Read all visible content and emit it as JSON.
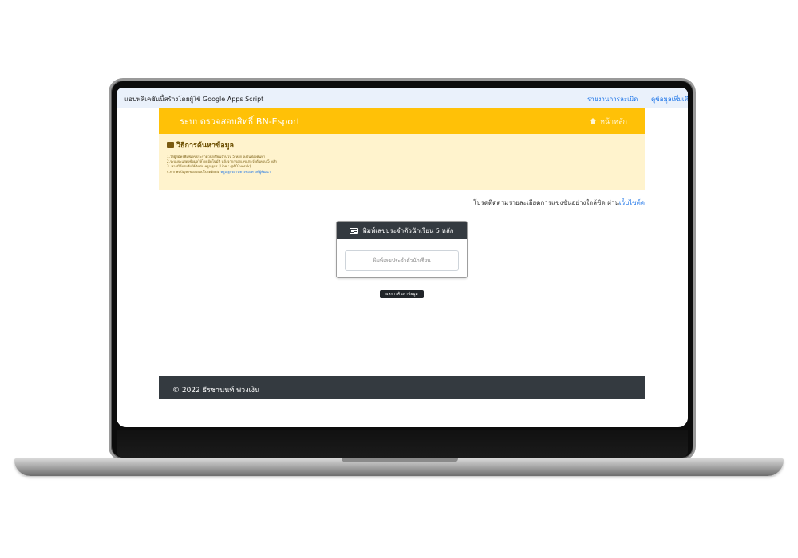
{
  "gas_banner": {
    "message": "แอปพลิเคชันนี้สร้างโดยผู้ใช้ Google Apps Script",
    "link_report": "รายงานการละเมิด",
    "link_more": "ดูข้อมูลเพิ่มเติม"
  },
  "navbar": {
    "brand": "ระบบตรวจสอบสิทธิ์ BN-Esport",
    "home": "หน้าหลัก"
  },
  "info": {
    "title": "วิธีการค้นหาข้อมูล",
    "steps": [
      "1.ให้ผู้สมัครพิมพ์เลขประจำตัวนักเรียนจำนวน 5 หลัก ลงในช่องค้นหา",
      "2.ระบบจะแสดงข้อมูลให้โดยอัตโนมัติ หลังจากกรอกเลขประจำตัวครบ 5 หลัก",
      "3. หากมีข้อสงสัยให้ติดต่อ ครูณฐกร (Line : @603vesvk)",
      "4.หากพบปัญหาของระบบโปรดติดต่อ"
    ],
    "step4_link": "ครูณฐกรผ่านทางช่องทางที่ผู้พัฒนา"
  },
  "notice": {
    "text": "โปรดติดตามรายละเอียดการแข่งขันอย่างใกล้ชิด ผ่าน",
    "link": "เว็บไซต์ด"
  },
  "search_card": {
    "header": "พิมพ์เลขประจำตัวนักเรียน 5 หลัก",
    "placeholder": "พิมพ์เลขประจำตัวนักเรียน"
  },
  "result_button": "ผลการค้นหาข้อมูล",
  "footer": "© 2022 ธีรชานนท์ พวงเงิน",
  "colors": {
    "navbar": "#ffc107",
    "info_bg": "#fff3cd",
    "dark": "#343a40",
    "link": "#1a73e8"
  }
}
